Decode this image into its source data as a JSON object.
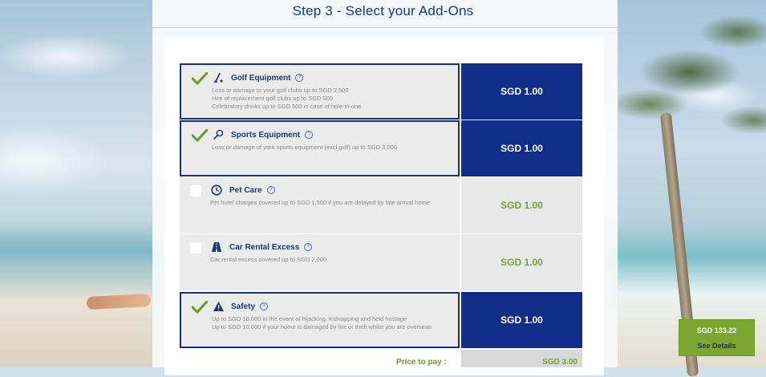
{
  "page": {
    "title": "Step 3 - Select your Add-Ons"
  },
  "colors": {
    "selected_price_bg": "#102d87",
    "selected_border": "#16307f",
    "accent_green": "#7aa031",
    "title_blue": "#1b3873"
  },
  "addons": [
    {
      "name": "Golf Equipment",
      "icon": "golf-club-icon",
      "selected": true,
      "price": "SGD 1.00",
      "details": [
        "Loss or damage to your golf clubs up to SGD 2,500",
        "Hire of replacement golf clubs up to SGD 500",
        "Celebratory drinks up to SGD 500 in case of hole-in-one"
      ]
    },
    {
      "name": "Sports Equipment",
      "icon": "racket-icon",
      "selected": true,
      "price": "SGD 1.00",
      "details": [
        "Loss or damage of your sports equipment (excl golf) up to SGD 3,000"
      ]
    },
    {
      "name": "Pet Care",
      "icon": "clock-icon",
      "selected": false,
      "price": "SGD 1.00",
      "details": [
        "Pet hotel charges covered up to SGD 1,500 if you are delayed by late arrival home"
      ]
    },
    {
      "name": "Car Rental Excess",
      "icon": "road-icon",
      "selected": false,
      "price": "SGD 1.00",
      "details": [
        "Car rental excess covered up to SGD 2,000"
      ]
    },
    {
      "name": "Safety",
      "icon": "warning-icon",
      "selected": true,
      "price": "SGD 1.00",
      "details": [
        "Up to SGD 10,000 in the event of hijacking, Kidnapping and held hostage",
        "Up to SGD 10,000 if your home is damaged by fire or theft whilst you are overseas"
      ]
    }
  ],
  "total": {
    "label": "Price to pay :",
    "value": "SGD 3.00"
  },
  "summary": {
    "amount": "SGD 133.22",
    "link": "See Details"
  }
}
